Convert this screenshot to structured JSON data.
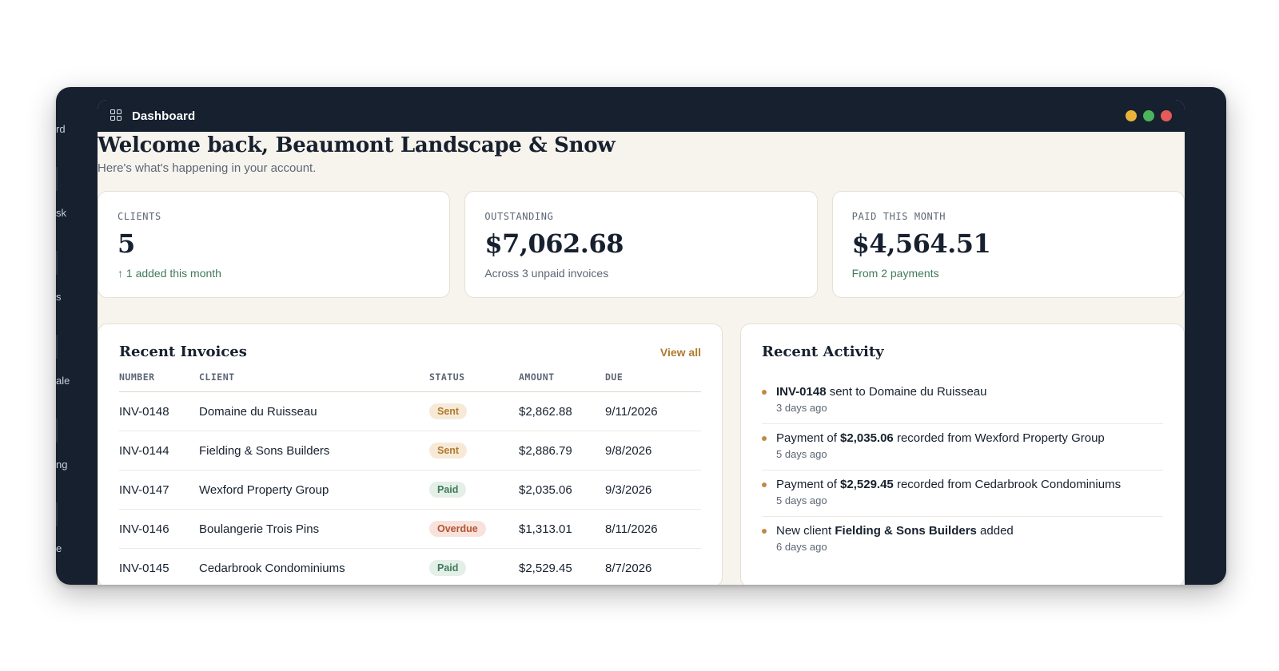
{
  "sidebar_peek": [
    "rd",
    "sk",
    "s",
    "ale",
    "ng",
    "e"
  ],
  "window": {
    "title": "Dashboard",
    "dots": [
      "#e9b33b",
      "#4cb45c",
      "#e65a57"
    ]
  },
  "welcome": {
    "title": "Welcome back, Beaumont Landscape & Snow",
    "subtitle": "Here's what's happening in your account."
  },
  "stats": [
    {
      "label": "CLIENTS",
      "value": "5",
      "note": "↑ 1 added this month"
    },
    {
      "label": "OUTSTANDING",
      "value": "$7,062.68",
      "note": "Across 3 unpaid invoices"
    },
    {
      "label": "PAID THIS MONTH",
      "value": "$4,564.51",
      "note": "From 2 payments"
    }
  ],
  "invoices": {
    "title": "Recent Invoices",
    "view_all": "View all",
    "columns": [
      "NUMBER",
      "CLIENT",
      "STATUS",
      "AMOUNT",
      "DUE"
    ],
    "rows": [
      {
        "number": "INV-0148",
        "client": "Domaine du Ruisseau",
        "status": "Sent",
        "amount": "$2,862.88",
        "due": "9/11/2026"
      },
      {
        "number": "INV-0144",
        "client": "Fielding & Sons Builders",
        "status": "Sent",
        "amount": "$2,886.79",
        "due": "9/8/2026"
      },
      {
        "number": "INV-0147",
        "client": "Wexford Property Group",
        "status": "Paid",
        "amount": "$2,035.06",
        "due": "9/3/2026"
      },
      {
        "number": "INV-0146",
        "client": "Boulangerie Trois Pins",
        "status": "Overdue",
        "amount": "$1,313.01",
        "due": "8/11/2026"
      },
      {
        "number": "INV-0145",
        "client": "Cedarbrook Condominiums",
        "status": "Paid",
        "amount": "$2,529.45",
        "due": "8/7/2026"
      }
    ]
  },
  "activity": {
    "title": "Recent Activity",
    "items": [
      {
        "pre": "",
        "bold": "INV-0148",
        "post": " sent to Domaine du Ruisseau",
        "time": "3 days ago"
      },
      {
        "pre": "Payment of ",
        "bold": "$2,035.06",
        "post": " recorded from Wexford Property Group",
        "time": "5 days ago"
      },
      {
        "pre": "Payment of ",
        "bold": "$2,529.45",
        "post": " recorded from Cedarbrook Condominiums",
        "time": "5 days ago"
      },
      {
        "pre": "New client ",
        "bold": "Fielding & Sons Builders",
        "post": " added",
        "time": "6 days ago"
      }
    ]
  },
  "colors": {
    "frame": "#16202f",
    "background": "#f7f4ee",
    "accent": "#b07a2e",
    "paid": "#3f7a5a",
    "overdue": "#b4532f"
  }
}
